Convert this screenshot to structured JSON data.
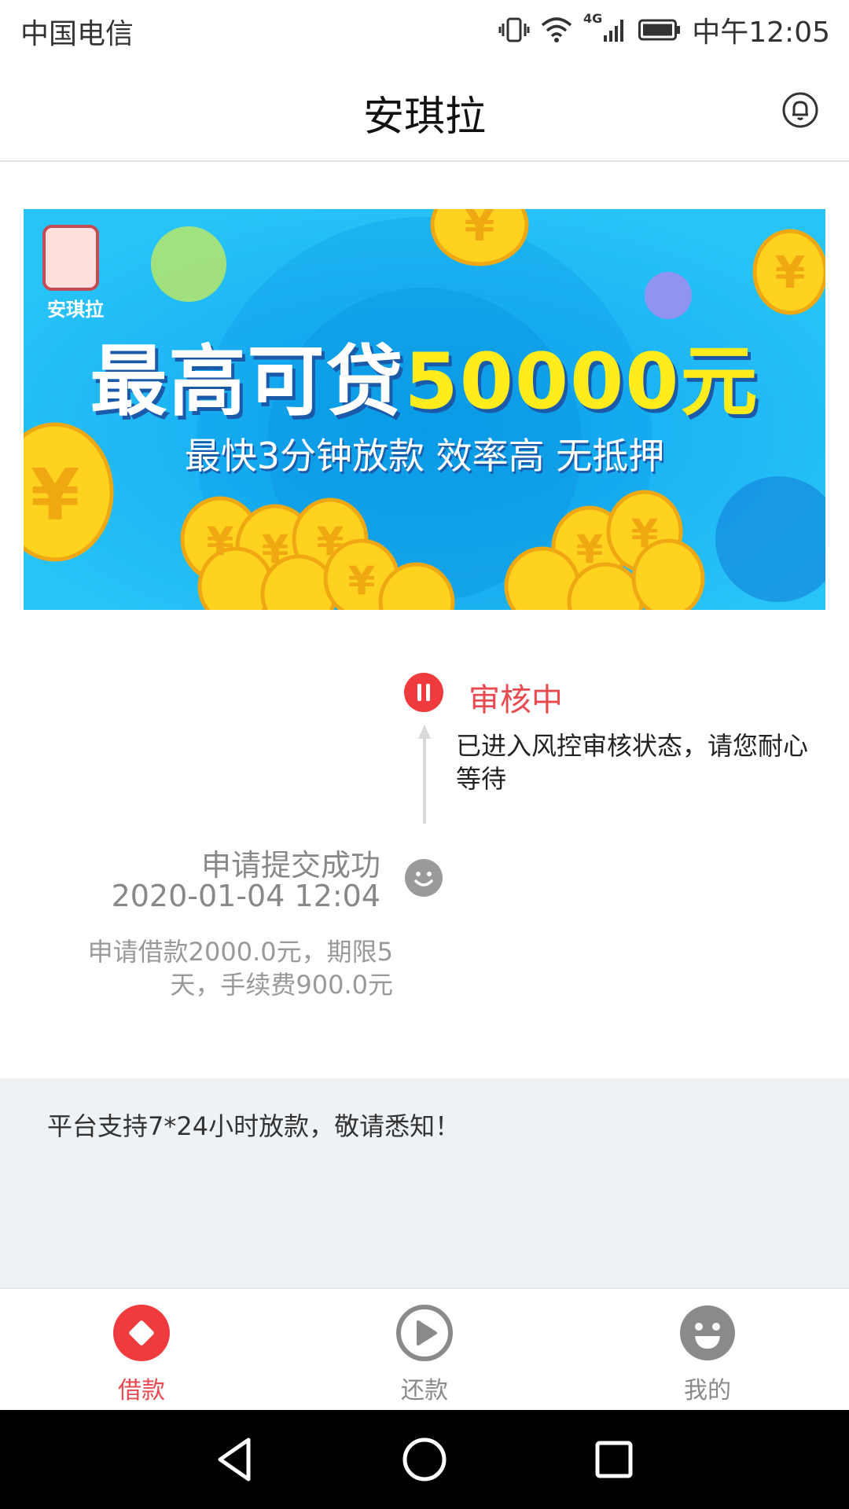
{
  "status_bar": {
    "carrier": "中国电信",
    "network_label": "4G",
    "time": "中午12:05",
    "icons": [
      "vibrate-icon",
      "wifi-icon",
      "signal-icon",
      "battery-icon"
    ]
  },
  "header": {
    "title": "安琪拉",
    "bell_icon": "bell-icon"
  },
  "banner": {
    "logo_text": "安琪拉",
    "headline_prefix": "最高可贷",
    "headline_amount": "50000元",
    "subline": "最快3分钟放款 效率高 无抵押"
  },
  "timeline": {
    "current": {
      "icon": "pause-icon",
      "title": "审核中",
      "description": "已进入风控审核状态，请您耐心等待"
    },
    "previous": {
      "icon": "smile-icon",
      "title": "申请提交成功",
      "time": "2020-01-04 12:04",
      "description": "申请借款2000.0元，期限5天，手续费900.0元"
    }
  },
  "notice": {
    "text": "平台支持7*24小时放款，敬请悉知！"
  },
  "tabs": [
    {
      "label": "借款",
      "icon": "loan-diamond-icon",
      "active": true
    },
    {
      "label": "还款",
      "icon": "play-icon",
      "active": false
    },
    {
      "label": "我的",
      "icon": "profile-smile-icon",
      "active": false
    }
  ],
  "colors": {
    "accent": "#ef3b3e",
    "banner_bg": "#1fb3f5",
    "coin": "#ffd21f",
    "notice_bg": "#eff2f5",
    "inactive": "#8a8a8a"
  }
}
